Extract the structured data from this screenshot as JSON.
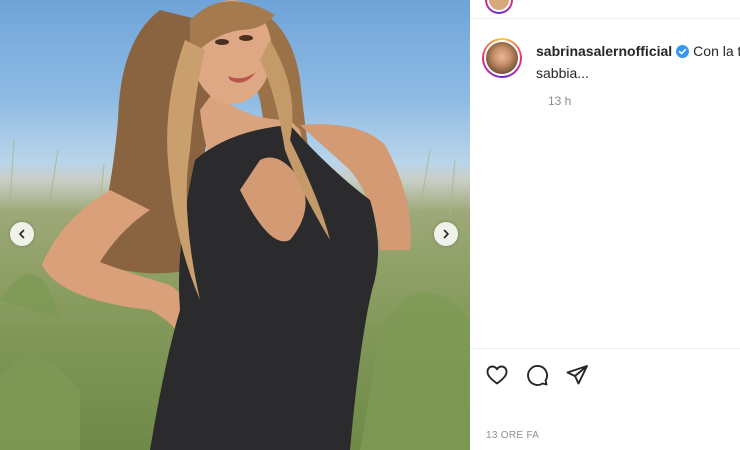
{
  "post": {
    "media": {
      "image_description": "",
      "carousel_prev_icon": "chevron-left-icon",
      "carousel_next_icon": "chevron-right-icon"
    },
    "caption": {
      "username": "sabrinasalernofficial",
      "verified": true,
      "text_line1": "Con la tes",
      "text_line2": "sabbia...",
      "timestamp": "13 h"
    },
    "actions": {
      "like_icon": "heart-icon",
      "comment_icon": "comment-icon",
      "share_icon": "send-icon"
    },
    "posted_ago": "13 ORE FA"
  },
  "colors": {
    "verified_badge": "#3897f0",
    "text_primary": "#262626",
    "text_secondary": "#8e8e8e",
    "story_ring": "#ee2a7b"
  }
}
